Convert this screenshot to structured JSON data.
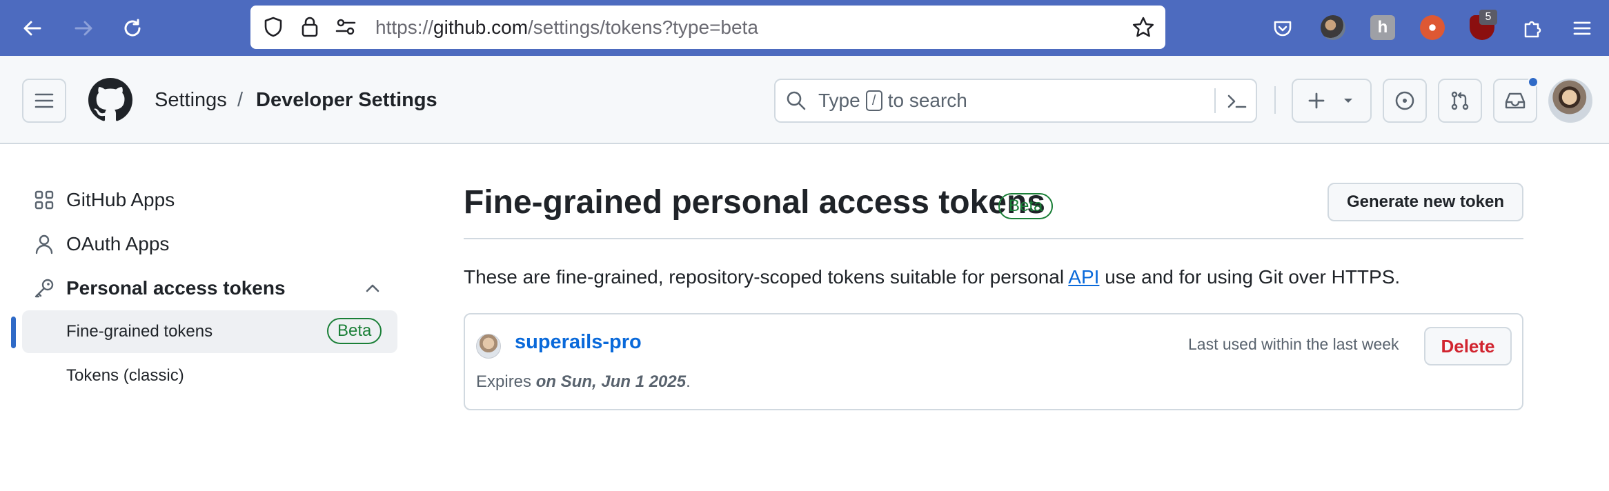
{
  "browser": {
    "url_prefix": "https://",
    "url_host": "github.com",
    "url_path": "/settings/tokens?type=beta",
    "extension_badge": "5"
  },
  "header": {
    "breadcrumb_settings": "Settings",
    "breadcrumb_separator": "/",
    "breadcrumb_current": "Developer Settings",
    "search_prefix": "Type",
    "search_key": "/",
    "search_suffix": "to search"
  },
  "sidebar": {
    "items": [
      {
        "label": "GitHub Apps",
        "icon": "apps-icon"
      },
      {
        "label": "OAuth Apps",
        "icon": "person-icon"
      },
      {
        "label": "Personal access tokens",
        "icon": "key-icon"
      }
    ],
    "sub_items": [
      {
        "label": "Fine-grained tokens",
        "badge": "Beta",
        "active": true
      },
      {
        "label": "Tokens (classic)",
        "active": false
      }
    ]
  },
  "main": {
    "title": "Fine-grained personal access tokens",
    "title_badge": "Beta",
    "generate_button": "Generate new token",
    "description_before": "These are fine-grained, repository-scoped tokens suitable for personal ",
    "description_link": "API",
    "description_after": " use and for using Git over HTTPS.",
    "tokens": [
      {
        "name": "superails-pro",
        "last_used": "Last used within the last week",
        "delete_label": "Delete",
        "expires_prefix": "Expires ",
        "expires_date": "on Sun, Jun 1 2025",
        "expires_suffix": "."
      }
    ]
  },
  "colors": {
    "browser_bar": "#4d6bbf",
    "link": "#0969da",
    "success": "#1a7f37",
    "danger": "#d1242f",
    "active_indicator": "#2f6ac7",
    "notification_dot": "#2f6ac7"
  }
}
